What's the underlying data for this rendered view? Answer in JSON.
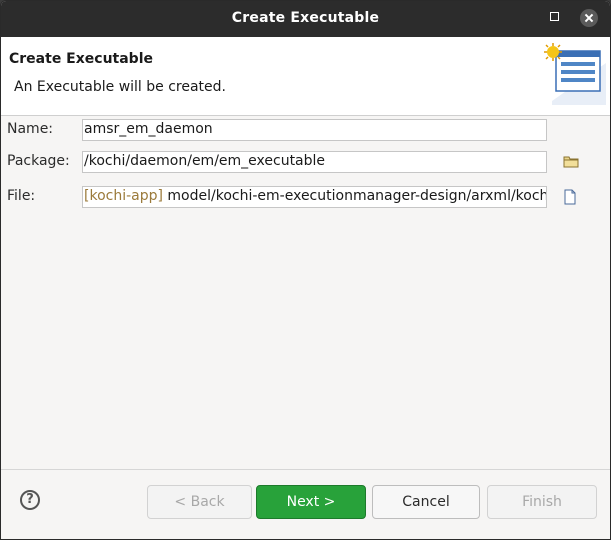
{
  "window": {
    "title": "Create Executable"
  },
  "header": {
    "title": "Create Executable",
    "description": "An Executable will be created."
  },
  "form": {
    "name_label": "Name:",
    "name_value": "amsr_em_daemon",
    "package_label": "Package:",
    "package_value": "/kochi/daemon/em/em_executable",
    "file_label": "File:",
    "file_prefix": "[kochi-app]",
    "file_value": " model/kochi-em-executionmanager-design/arxml/kochi_ex"
  },
  "buttons": {
    "help": "?",
    "back": "< Back",
    "next": "Next >",
    "cancel": "Cancel",
    "finish": "Finish"
  },
  "icons": {
    "minimize": "minimize-icon",
    "close": "close-icon",
    "wizard": "wizard-banner-icon",
    "package": "folder-icon",
    "file": "file-icon"
  },
  "colors": {
    "titlebar": "#2c2c2c",
    "primary_button": "#28a23a",
    "file_prefix": "#9b7a3a"
  }
}
